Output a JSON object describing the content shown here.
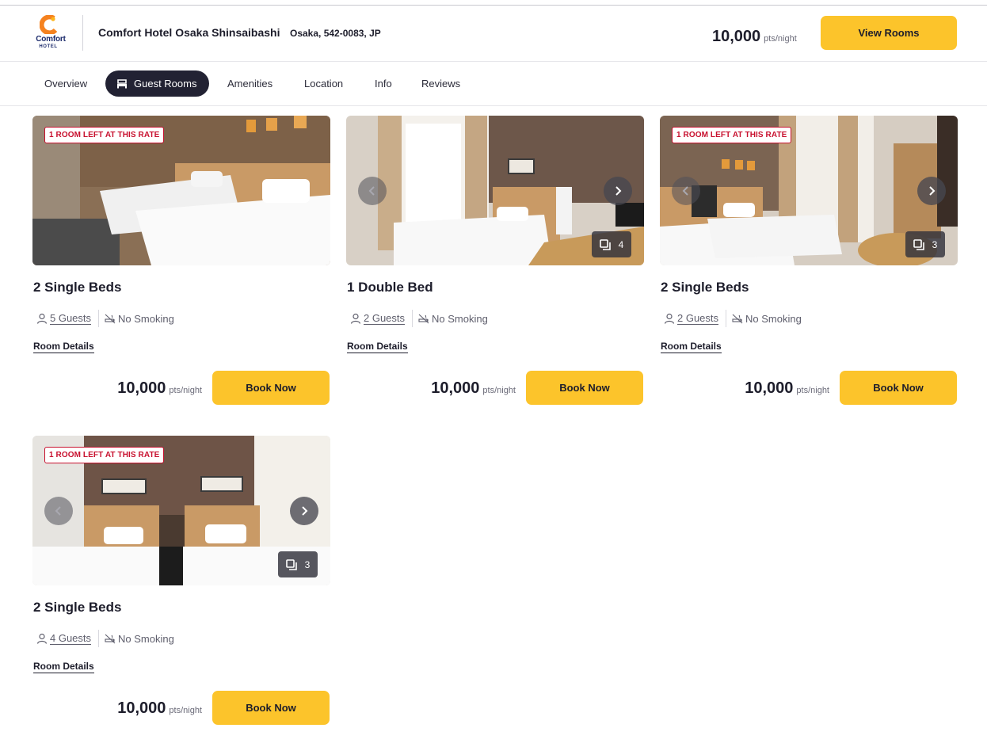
{
  "header": {
    "logo_word": "Comfort",
    "logo_sub": "HOTEL",
    "hotel_name": "Comfort Hotel Osaka Shinsaibashi",
    "address": "Osaka, 542-0083, JP",
    "price": "10,000",
    "price_unit": "pts/night",
    "view_rooms_label": "View Rooms"
  },
  "tabs": [
    {
      "label": "Overview",
      "active": false
    },
    {
      "label": "Guest Rooms",
      "active": true,
      "icon": "bed-icon"
    },
    {
      "label": "Amenities",
      "active": false
    },
    {
      "label": "Location",
      "active": false
    },
    {
      "label": "Info",
      "active": false
    },
    {
      "label": "Reviews",
      "active": false
    }
  ],
  "rooms": [
    {
      "title": "2 Single Beds",
      "badge": "1 ROOM LEFT AT THIS RATE",
      "guests": "5 Guests",
      "smoking": "No Smoking",
      "details_label": "Room Details",
      "price": "10,000",
      "price_unit": "pts/night",
      "book_label": "Book Now"
    },
    {
      "title": "1 Double Bed",
      "photo_count": "4",
      "guests": "2 Guests",
      "smoking": "No Smoking",
      "details_label": "Room Details",
      "price": "10,000",
      "price_unit": "pts/night",
      "book_label": "Book Now"
    },
    {
      "title": "2 Single Beds",
      "badge": "1 ROOM LEFT AT THIS RATE",
      "photo_count": "3",
      "guests": "2 Guests",
      "smoking": "No Smoking",
      "details_label": "Room Details",
      "price": "10,000",
      "price_unit": "pts/night",
      "book_label": "Book Now"
    },
    {
      "title": "2 Single Beds",
      "badge": "1 ROOM LEFT AT THIS RATE",
      "photo_count": "3",
      "guests": "4 Guests",
      "smoking": "No Smoking",
      "details_label": "Room Details",
      "price": "10,000",
      "price_unit": "pts/night",
      "book_label": "Book Now"
    }
  ],
  "colors": {
    "accent": "#fcc42b",
    "badge_red": "#c8102e",
    "tab_active": "#222233",
    "text": "#1d1d2b"
  }
}
